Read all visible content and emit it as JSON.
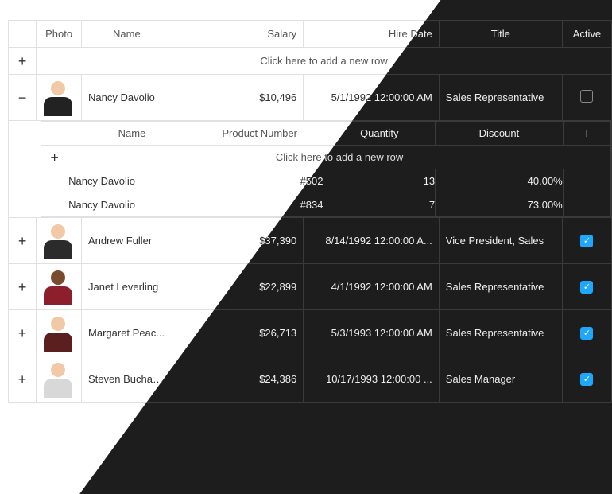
{
  "headers": {
    "photo": "Photo",
    "name": "Name",
    "salary": "Salary",
    "hire_date": "Hire Date",
    "title": "Title",
    "active": "Active"
  },
  "add_row_text": "Click here to add a new row",
  "detail_headers": {
    "name": "Name",
    "product_number": "Product Number",
    "quantity": "Quantity",
    "discount": "Discount",
    "extra_truncated": "T"
  },
  "detail_add_row_text": "Click here to add a new row",
  "rows": [
    {
      "expanded": true,
      "name": "Nancy Davolio",
      "salary": "$10,496",
      "hire_date": "5/1/1992 12:00:00 AM",
      "title": "Sales Representative",
      "active": false,
      "details": [
        {
          "name": "Nancy Davolio",
          "product_number": "#502",
          "quantity": "13",
          "discount": "40.00%"
        },
        {
          "name": "Nancy Davolio",
          "product_number": "#834",
          "quantity": "7",
          "discount": "73.00%"
        }
      ]
    },
    {
      "expanded": false,
      "name": "Andrew Fuller",
      "salary": "$37,390",
      "hire_date": "8/14/1992 12:00:00 A...",
      "title": "Vice President, Sales",
      "active": true
    },
    {
      "expanded": false,
      "name": "Janet Leverling",
      "salary": "$22,899",
      "hire_date": "4/1/1992 12:00:00 AM",
      "title": "Sales Representative",
      "active": true
    },
    {
      "expanded": false,
      "name": "Margaret  Peac...",
      "salary": "$26,713",
      "hire_date": "5/3/1993 12:00:00 AM",
      "title": "Sales Representative",
      "active": true
    },
    {
      "expanded": false,
      "name": "Steven  Buchan...",
      "salary": "$24,386",
      "hire_date": "10/17/1993 12:00:00 ...",
      "title": "Sales Manager",
      "active": true
    }
  ]
}
